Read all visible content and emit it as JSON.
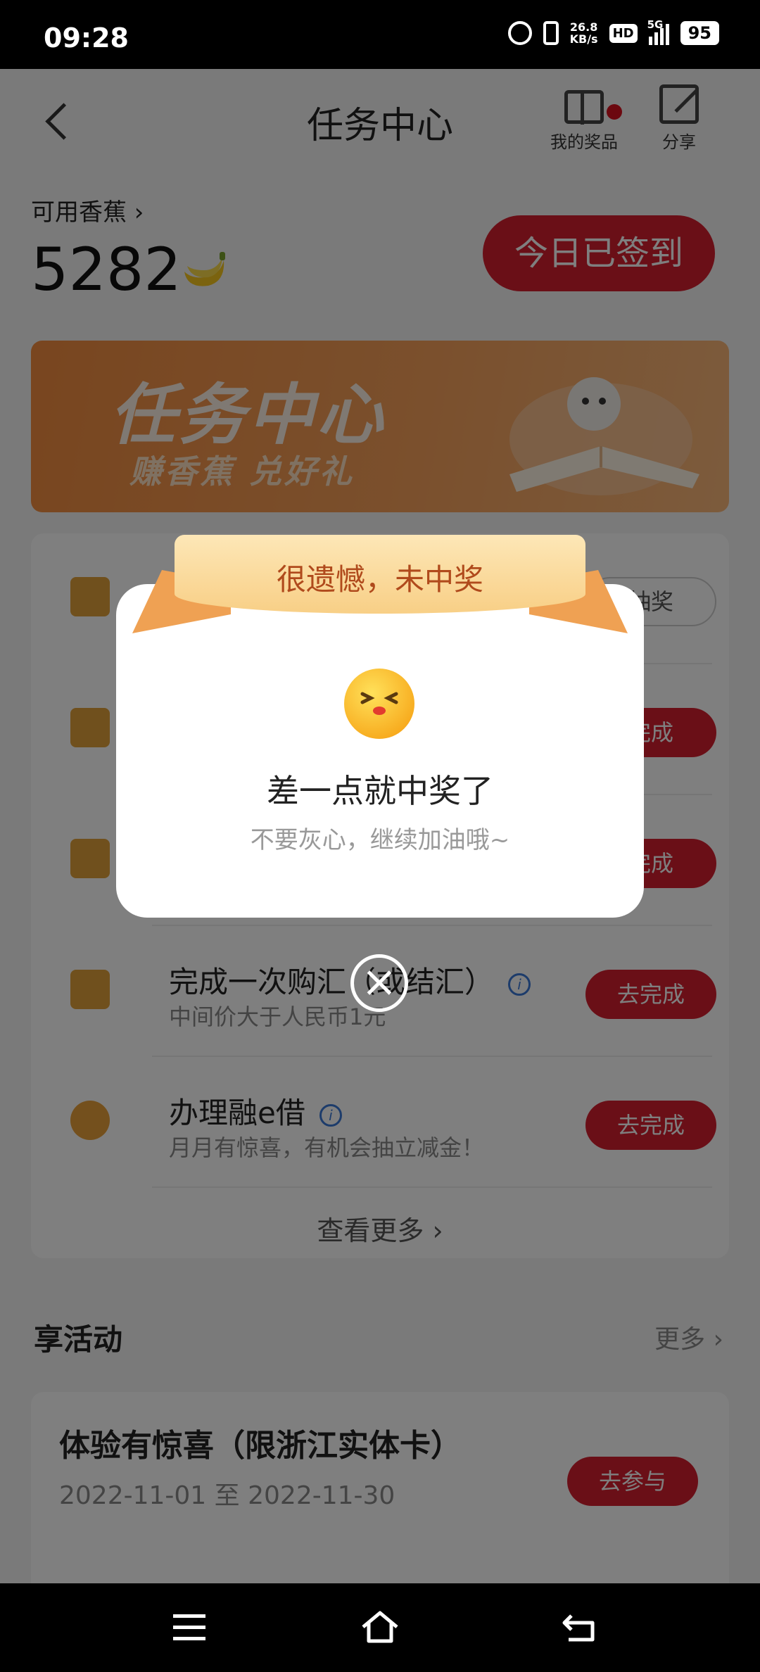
{
  "status_bar": {
    "time": "09:28",
    "net_speed": "26.8",
    "net_unit": "KB/s",
    "hd": "HD",
    "network": "5G",
    "battery": "95"
  },
  "header": {
    "title": "任务中心",
    "prizes_label": "我的奖品",
    "share_label": "分享"
  },
  "balance": {
    "label": "可用香蕉 ›",
    "value": "5282",
    "signed_label": "今日已签到"
  },
  "banner": {
    "title": "任务中心",
    "subtitle": "赚香蕉 兑好礼"
  },
  "tasks": [
    {
      "title": "",
      "subtitle": "",
      "button": "抽奖",
      "icon": "phone-icon"
    },
    {
      "title": "",
      "subtitle": "",
      "button": "完成",
      "icon": "chart-icon"
    },
    {
      "title": "",
      "subtitle": "",
      "button": "完成",
      "icon": "abacus-icon"
    },
    {
      "title": "完成一次购汇（或结汇）",
      "subtitle": "中间价大于人民币1元",
      "button": "去完成",
      "icon": "calendar-icon"
    },
    {
      "title": "办理融e借",
      "subtitle": "月月有惊喜，有机会抽立减金！",
      "button": "去完成",
      "icon": "piggy-icon"
    }
  ],
  "more_tasks": "查看更多 ›",
  "activities": {
    "heading": "享活动",
    "more": "更多 ›",
    "items": [
      {
        "title": "体验有惊喜（限浙江实体卡）",
        "date": "2022-11-01 至 2022-11-30",
        "button": "去参与"
      }
    ]
  },
  "modal": {
    "ribbon": "很遗憾，未中奖",
    "title": "差一点就中奖了",
    "subtitle": "不要灰心，继续加油哦~"
  },
  "colors": {
    "accent": "#d41f2e",
    "ribbon": "#f8cf86",
    "ribbon_text": "#b04a1c",
    "banner": "#f28c3f"
  }
}
